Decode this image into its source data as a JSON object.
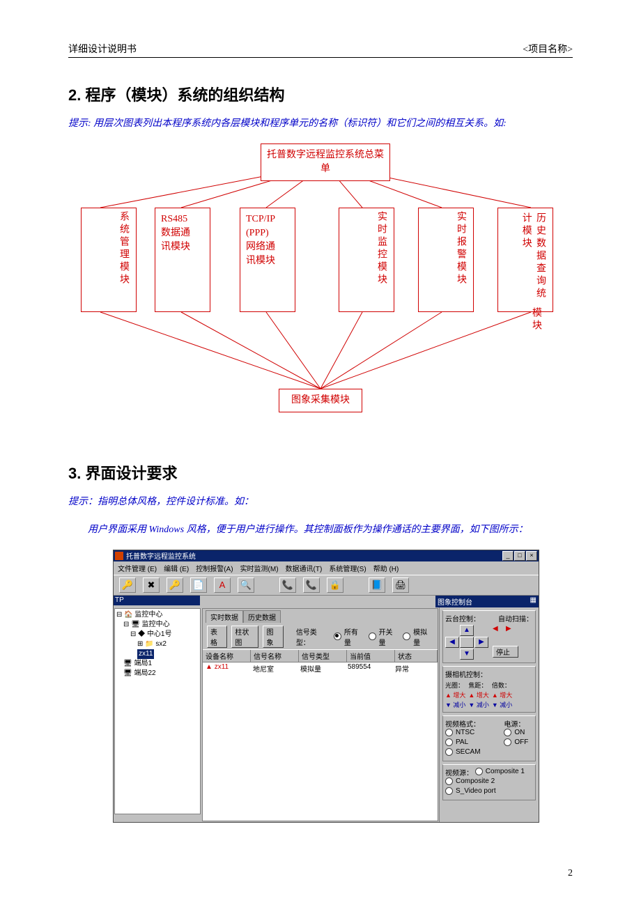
{
  "header": {
    "left": "详细设计说明书",
    "right": "<项目名称>"
  },
  "section2": {
    "title": "2. 程序（模块）系统的组织结构",
    "tip": "提示: 用层次图表列出本程序系统内各层模块和程序单元的名称（标识符）和它们之间的相互关系。如:"
  },
  "diagram": {
    "root": "托普数字远程监控系统总菜单",
    "modules": [
      "系统管理模块",
      "RS485\n数据通\n讯模块",
      "TCP/IP\n(PPP)\n网络通\n讯模块",
      "实时监控模块",
      "实时报警模块",
      "历史数据查询统计模块"
    ],
    "modules_extra": "模块",
    "child": "图象采集模块"
  },
  "section3": {
    "title": "3. 界面设计要求",
    "tip1": "提示：指明总体风格，控件设计标准。如：",
    "tip2": "用户界面采用 Windows 风格，便于用户进行操作。其控制面板作为操作通话的主要界面，如下图所示："
  },
  "app": {
    "title": "托普数字远程监控系统",
    "menus": [
      "文件管理 (E)",
      "编辑 (E)",
      "控制报警(A)",
      "实时监测(M)",
      "数据通讯(T)",
      "系统管理(S)",
      "帮助 (H)"
    ],
    "toolbar_glyphs": [
      "🔑",
      "✖",
      "🔑",
      "📄",
      "A",
      "🔍",
      "",
      "📞",
      "📞",
      "🔒",
      "",
      "📘",
      "🖨"
    ],
    "smallbar": "TP",
    "panel_title": "图象控制台",
    "tree": {
      "root": "监控中心",
      "items": [
        "监控中心",
        "中心1号",
        "sx2",
        "zx11",
        "端局1",
        "端局22"
      ]
    },
    "tabs": [
      "实时数据",
      "历史数据"
    ],
    "toolbar2": {
      "biaoge": "表格",
      "pillar": "柱状图",
      "image": "图象",
      "sigtype": "信号类型：",
      "opts": [
        "所有量",
        "开关量",
        "模拟量"
      ]
    },
    "thead": [
      "设备名称",
      "信号名称",
      "信号类型",
      "当前值",
      "状态"
    ],
    "trow": [
      "zx11",
      "地尼室",
      "模拟量",
      "589554",
      "异常"
    ],
    "rp": {
      "ptz": "云台控制：",
      "autoscan": "自动扫描：",
      "stop": "停止",
      "cam": "摄相机控制：",
      "cols": [
        "光圈：",
        "焦距：",
        "倍数："
      ],
      "inc": "▲ 增大",
      "dec": "▼ 减小",
      "vfmt": "视频格式：",
      "vfmt_opts": [
        "NTSC",
        "PAL",
        "SECAM"
      ],
      "power": "电源：",
      "power_opts": [
        "ON",
        "OFF"
      ],
      "vsrc": "视频源：",
      "vsrc_opts": [
        "Composite 1",
        "Composite 2",
        "S_Video port"
      ]
    }
  },
  "page_number": "2"
}
